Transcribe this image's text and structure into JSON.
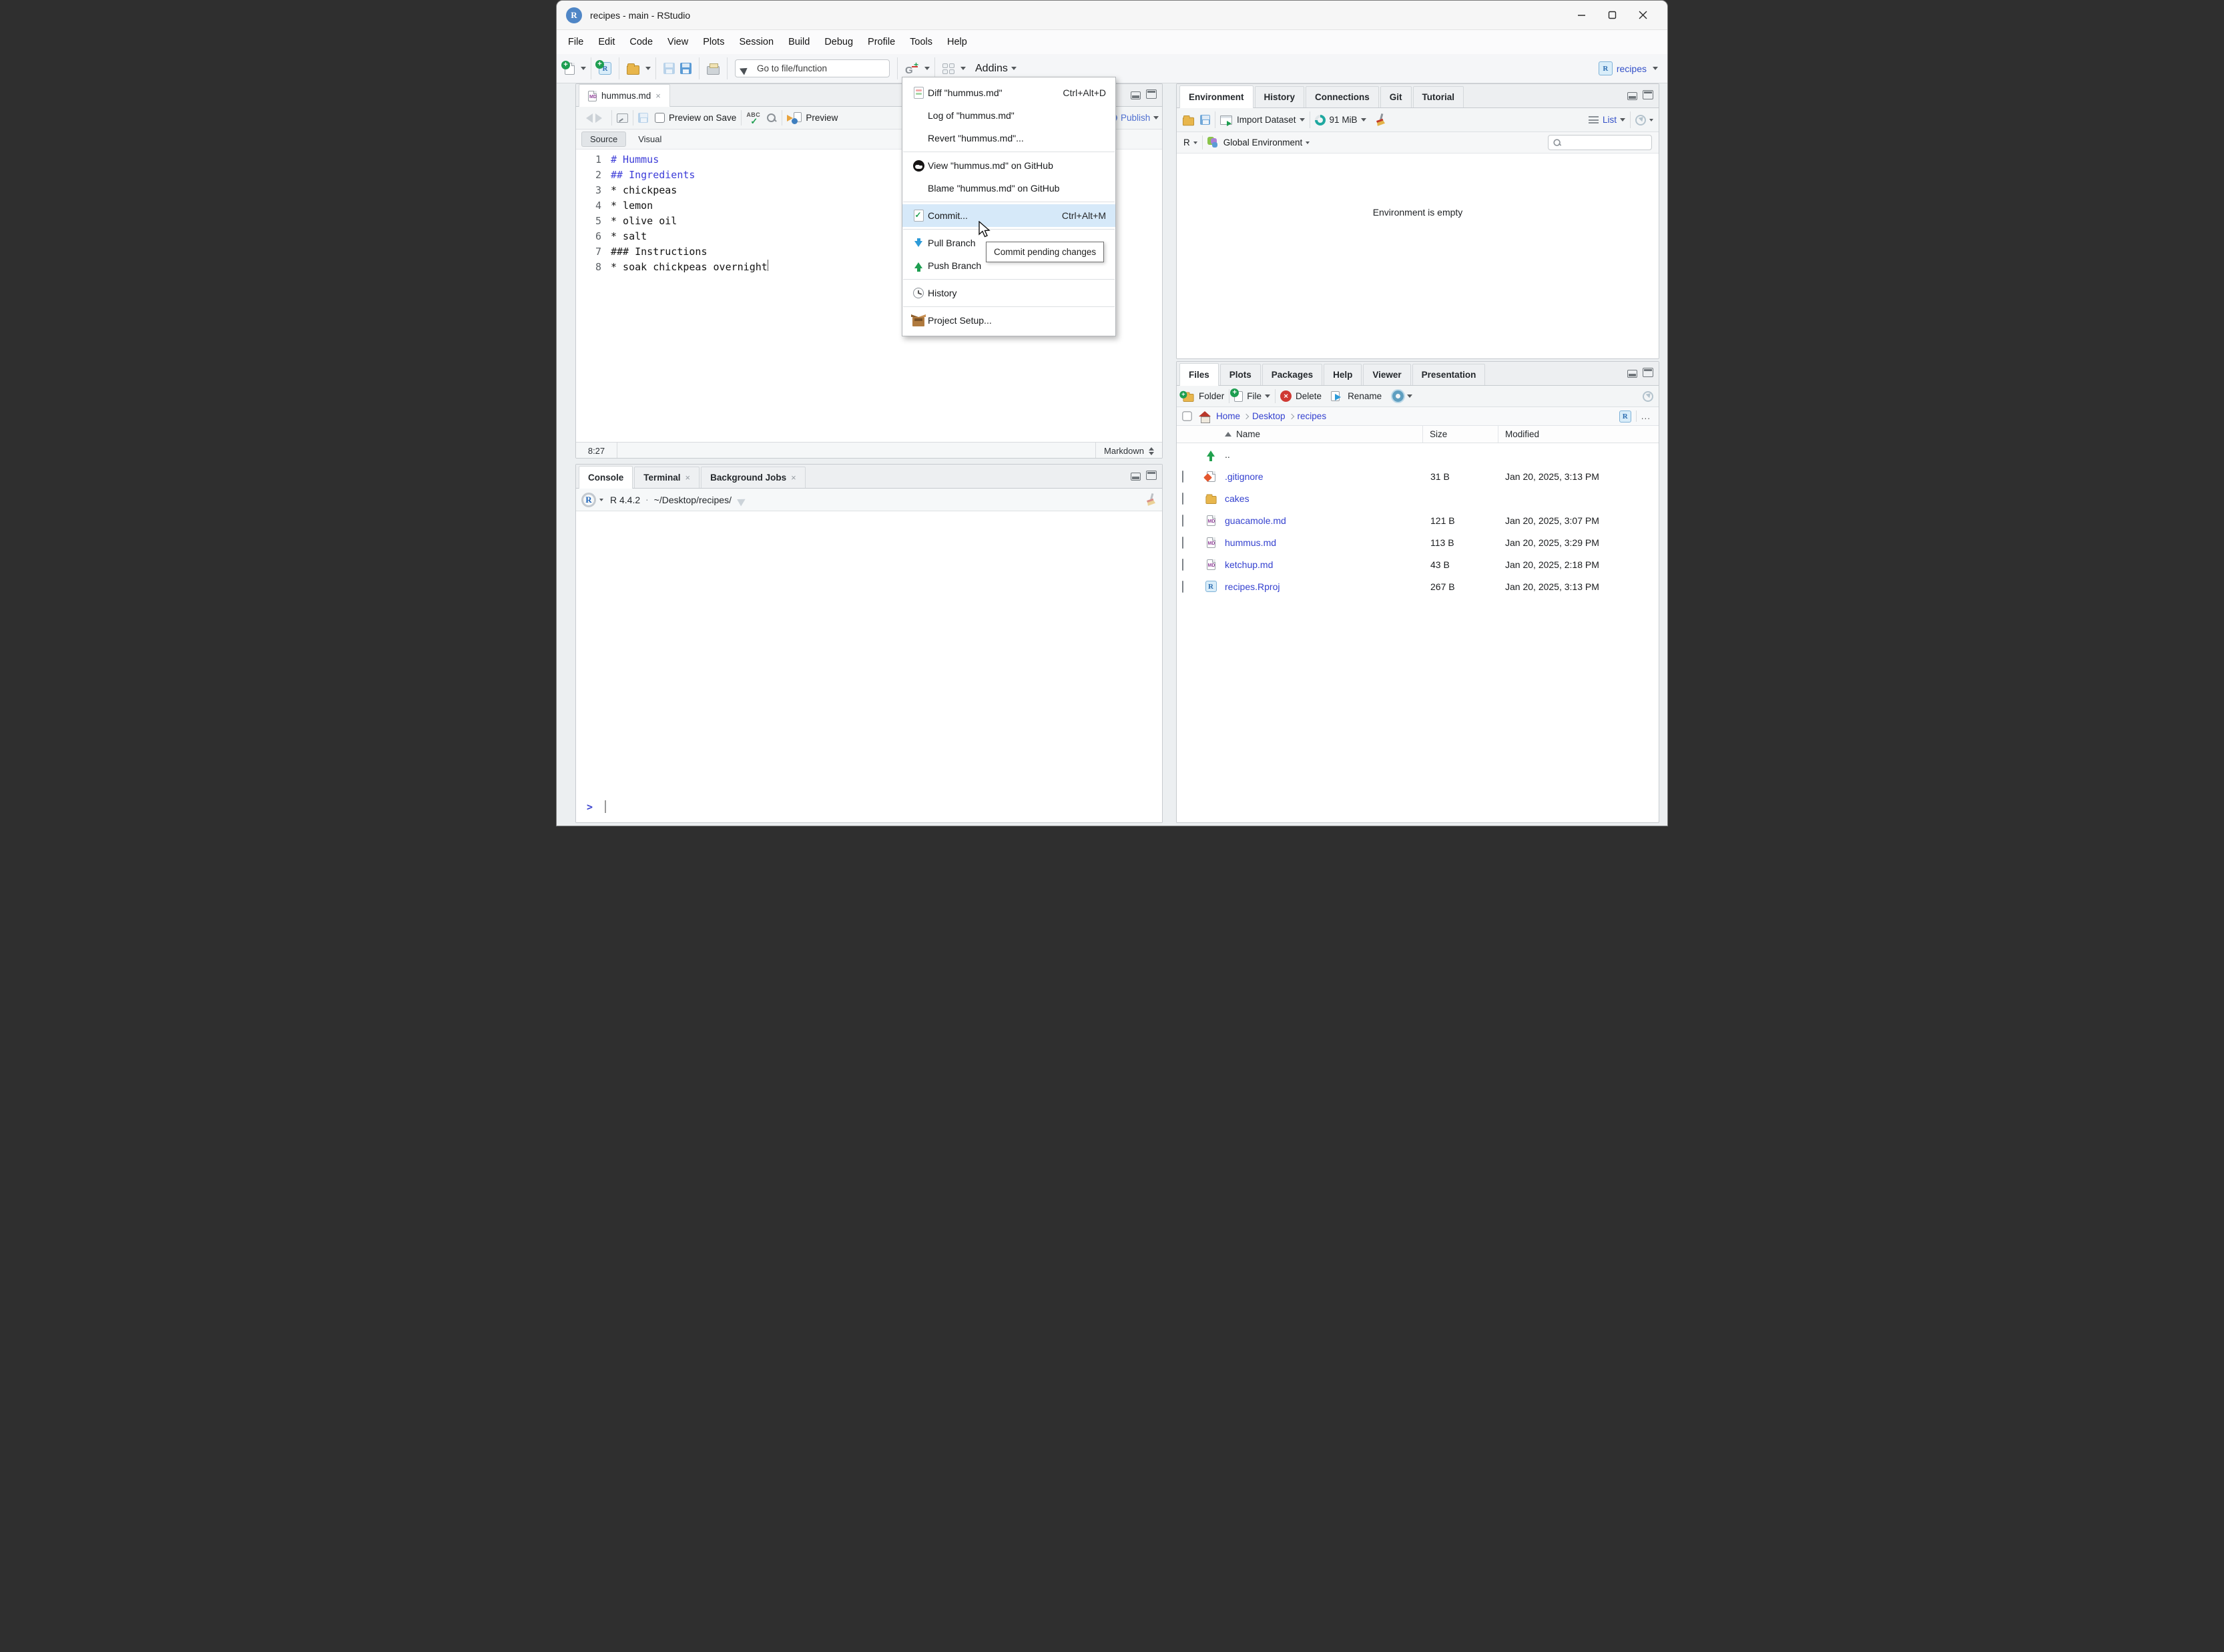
{
  "window": {
    "title": "recipes - main - RStudio"
  },
  "icons": {
    "close": "×",
    "md": "MD",
    "r": "R",
    "g": "G",
    "abc": "ABC",
    "dots": "...",
    "dot": "·"
  },
  "menu_bar": {
    "items": [
      "File",
      "Edit",
      "Code",
      "View",
      "Plots",
      "Session",
      "Build",
      "Debug",
      "Profile",
      "Tools",
      "Help"
    ]
  },
  "toolbar": {
    "goto_placeholder": "Go to file/function",
    "addins_label": "Addins",
    "project_name": "recipes"
  },
  "git_menu": {
    "items": [
      {
        "label": "Diff \"hummus.md\"",
        "shortcut": "Ctrl+Alt+D"
      },
      {
        "label": "Log of \"hummus.md\"",
        "shortcut": ""
      },
      {
        "label": "Revert \"hummus.md\"...",
        "shortcut": ""
      },
      {
        "label": "View \"hummus.md\" on GitHub",
        "shortcut": ""
      },
      {
        "label": "Blame \"hummus.md\" on GitHub",
        "shortcut": ""
      },
      {
        "label": "Commit...",
        "shortcut": "Ctrl+Alt+M"
      },
      {
        "label": "Pull Branch",
        "shortcut": ""
      },
      {
        "label": "Push Branch",
        "shortcut": ""
      },
      {
        "label": "History",
        "shortcut": ""
      },
      {
        "label": "Project Setup...",
        "shortcut": ""
      }
    ]
  },
  "tooltip": {
    "text": "Commit pending changes"
  },
  "source_pane": {
    "tab_title": "hummus.md",
    "toolbar": {
      "preview_on_save": "Preview on Save",
      "preview": "Preview",
      "publish": "Publish"
    },
    "mode_tabs": {
      "source": "Source",
      "visual": "Visual"
    },
    "editor": {
      "lines": [
        {
          "num": "1",
          "text": "# Hummus"
        },
        {
          "num": "2",
          "text": "## Ingredients"
        },
        {
          "num": "3",
          "text": "* chickpeas"
        },
        {
          "num": "4",
          "text": "* lemon"
        },
        {
          "num": "5",
          "text": "* olive oil"
        },
        {
          "num": "6",
          "text": "* salt"
        },
        {
          "num": "7",
          "text": "### Instructions"
        },
        {
          "num": "8",
          "text": "* soak chickpeas overnight"
        }
      ]
    },
    "status": {
      "position": "8:27",
      "doc_type": "Markdown"
    }
  },
  "console_pane": {
    "tabs": [
      "Console",
      "Terminal",
      "Background Jobs"
    ],
    "r_version": "R 4.4.2",
    "working_dir": "~/Desktop/recipes/",
    "prompt": ">"
  },
  "environment_pane": {
    "tabs": [
      "Environment",
      "History",
      "Connections",
      "Git",
      "Tutorial"
    ],
    "toolbar": {
      "import_dataset": "Import Dataset",
      "memory": "91 MiB",
      "list_label": "List"
    },
    "scope": {
      "language": "R",
      "environment": "Global Environment"
    },
    "empty_message": "Environment is empty"
  },
  "files_pane": {
    "tabs": [
      "Files",
      "Plots",
      "Packages",
      "Help",
      "Viewer",
      "Presentation"
    ],
    "toolbar": {
      "new_folder": "Folder",
      "new_file": "File",
      "delete": "Delete",
      "rename": "Rename"
    },
    "breadcrumb": {
      "items": [
        "Home",
        "Desktop",
        "recipes"
      ]
    },
    "columns": {
      "name": "Name",
      "size": "Size",
      "modified": "Modified"
    },
    "rows": [
      {
        "name": "..",
        "size": "",
        "modified": ""
      },
      {
        "name": ".gitignore",
        "size": "31 B",
        "modified": "Jan 20, 2025, 3:13 PM"
      },
      {
        "name": "cakes",
        "size": "",
        "modified": ""
      },
      {
        "name": "guacamole.md",
        "size": "121 B",
        "modified": "Jan 20, 2025, 3:07 PM"
      },
      {
        "name": "hummus.md",
        "size": "113 B",
        "modified": "Jan 20, 2025, 3:29 PM"
      },
      {
        "name": "ketchup.md",
        "size": "43 B",
        "modified": "Jan 20, 2025, 2:18 PM"
      },
      {
        "name": "recipes.Rproj",
        "size": "267 B",
        "modified": "Jan 20, 2025, 3:13 PM"
      }
    ]
  }
}
